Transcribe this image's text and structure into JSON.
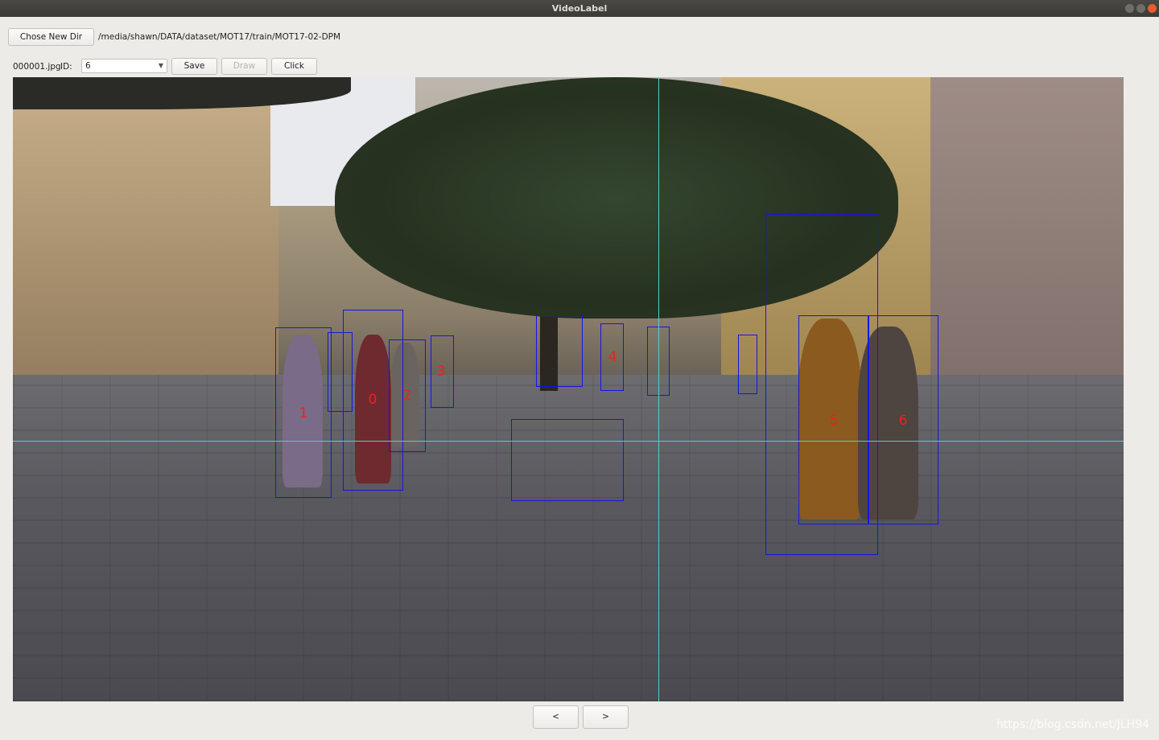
{
  "window": {
    "title": "VideoLabel"
  },
  "toolbar": {
    "chose_dir_label": "Chose New Dir",
    "dir_path": "/media/shawn/DATA/dataset/MOT17/train/MOT17-02-DPM",
    "filename": "000001.jpg",
    "id_label": "ID:",
    "id_value": "6",
    "save_label": "Save",
    "draw_label": "Draw",
    "click_label": "Click"
  },
  "boxes": {
    "labels": [
      "0",
      "1",
      "2",
      "3",
      "4",
      "5",
      "6"
    ],
    "color": "#1515e6",
    "label_color": "#ee2020"
  },
  "nav": {
    "prev_label": "<",
    "next_label": ">"
  },
  "watermark": "https://blog.csdn.net/JLH94"
}
